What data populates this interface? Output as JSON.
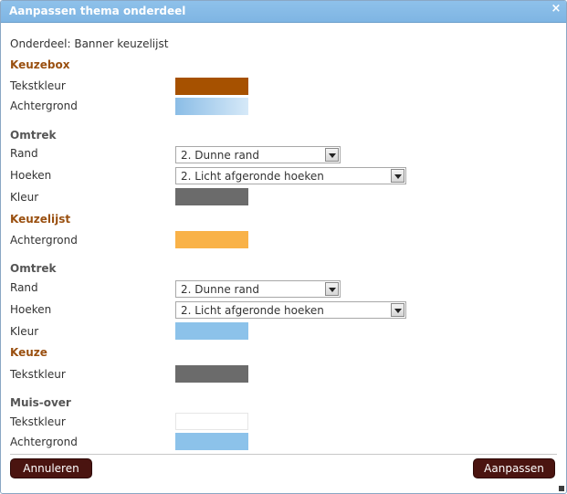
{
  "dialog": {
    "title": "Aanpassen thema onderdeel",
    "close_glyph": "×"
  },
  "component_label": "Onderdeel: Banner keuzelijst",
  "sections": {
    "keuzebox": {
      "title": "Keuzebox",
      "text_color_label": "Tekstkleur",
      "background_label": "Achtergrond",
      "text_color": "#a65100",
      "background_start": "#8bbde6",
      "background_end": "#d6e9f8"
    },
    "omtrek1": {
      "title": "Omtrek",
      "border_label": "Rand",
      "border_value": "2. Dunne rand",
      "corners_label": "Hoeken",
      "corners_value": "2. Licht afgeronde hoeken",
      "color_label": "Kleur",
      "color": "#6b6b6b"
    },
    "keuzelijst": {
      "title": "Keuzelijst",
      "background_label": "Achtergrond",
      "background": "#f9b248"
    },
    "omtrek2": {
      "title": "Omtrek",
      "border_label": "Rand",
      "border_value": "2. Dunne rand",
      "corners_label": "Hoeken",
      "corners_value": "2. Licht afgeronde hoeken",
      "color_label": "Kleur",
      "color": "#8cc2ea"
    },
    "keuze": {
      "title": "Keuze",
      "text_color_label": "Tekstkleur",
      "text_color": "#6b6b6b"
    },
    "muisover": {
      "title": "Muis-over",
      "text_color_label": "Tekstkleur",
      "text_color": "#ffffff",
      "background_label": "Achtergrond",
      "background": "#8cc2ea"
    }
  },
  "buttons": {
    "cancel_label": "Annuleren",
    "apply_label": "Aanpassen",
    "color": "#4a1410"
  }
}
